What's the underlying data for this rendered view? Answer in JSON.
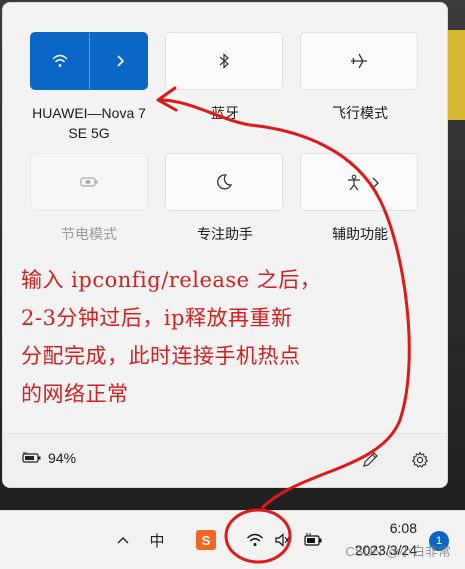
{
  "quick_settings": {
    "wifi": {
      "label": "HUAWEI—Nova 7 SE 5G",
      "label_line1": "HUAWEI—Nova 7",
      "label_line2": "SE 5G",
      "state": "on"
    },
    "bluetooth": {
      "label": "蓝牙"
    },
    "airplane": {
      "label": "飞行模式"
    },
    "battery_saver": {
      "label": "节电模式",
      "state": "disabled"
    },
    "focus_assist": {
      "label": "专注助手"
    },
    "accessibility": {
      "label": "辅助功能"
    }
  },
  "annotation": {
    "line1": "输入 ipconfig/release 之后，",
    "line2": "2-3分钟过后，ip释放再重新",
    "line3": "分配完成，此时连接手机热点",
    "line4": "的网络正常"
  },
  "footer": {
    "battery_percent": "94%",
    "edit_icon": "pencil-icon",
    "settings_icon": "gear-icon"
  },
  "taskbar": {
    "ime_label": "中",
    "sogou_label": "S",
    "time": "6:08",
    "date": "2023/3/24",
    "notification_count": "1",
    "watermark": "CSDN @小白非常"
  },
  "colors": {
    "accent": "#0a67c5",
    "annotation_red": "#d42020"
  }
}
